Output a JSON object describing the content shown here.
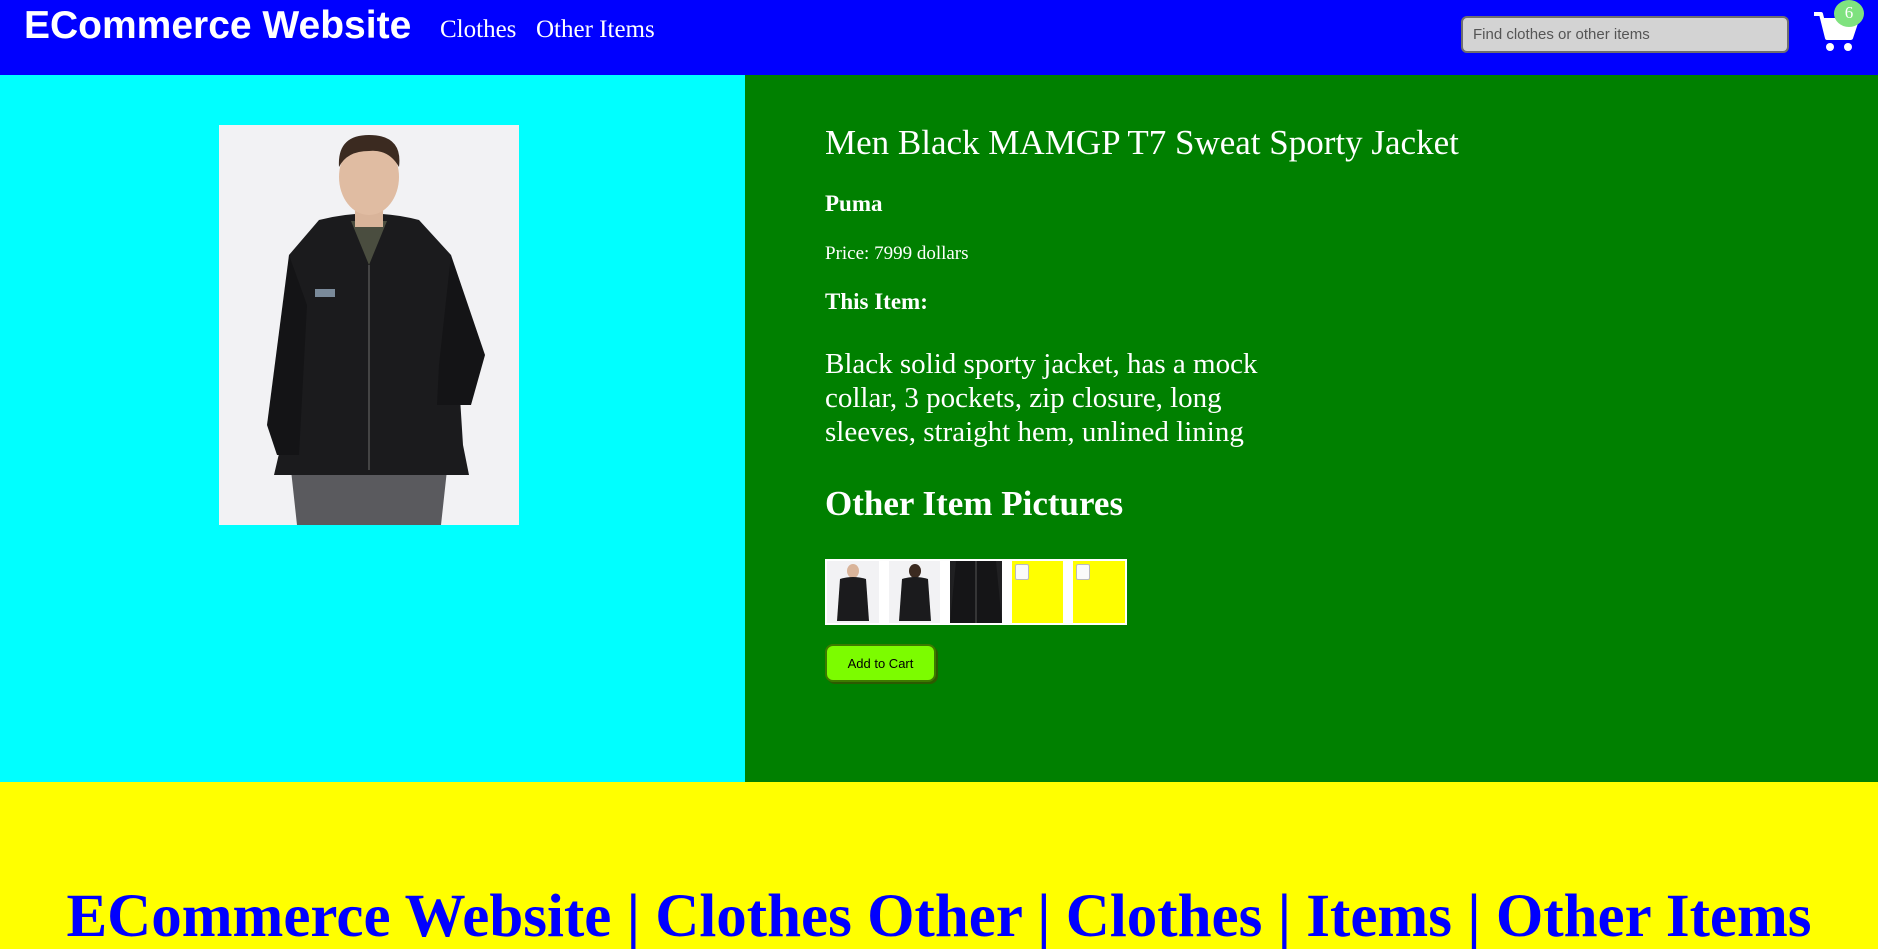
{
  "header": {
    "brand": "ECommerce Website",
    "nav": [
      "Clothes",
      "Other Items"
    ],
    "search_placeholder": "Find clothes or other items",
    "cart_count": "6",
    "cart_icon": "shopping-cart-icon"
  },
  "product": {
    "title": "Men Black MAMGP T7 Sweat Sporty Jacket",
    "brand": "Puma",
    "price": "Price: 7999 dollars",
    "this_item_label": "This Item:",
    "description": "Black solid sporty jacket, has a mock collar, 3 pockets, zip closure, long sleeves, straight hem, unlined lining",
    "other_pictures_title": "Other Item Pictures",
    "add_to_cart": "Add to Cart"
  },
  "footer": {
    "text": "ECommerce Website | Clothes Other | Clothes | Items | Other Items"
  },
  "colors": {
    "header_bg": "#0000ff",
    "image_panel_bg": "#00ffff",
    "details_panel_bg": "#008000",
    "footer_bg": "#ffff00",
    "footer_text": "#0000ff",
    "button_bg": "#7cfc00"
  }
}
